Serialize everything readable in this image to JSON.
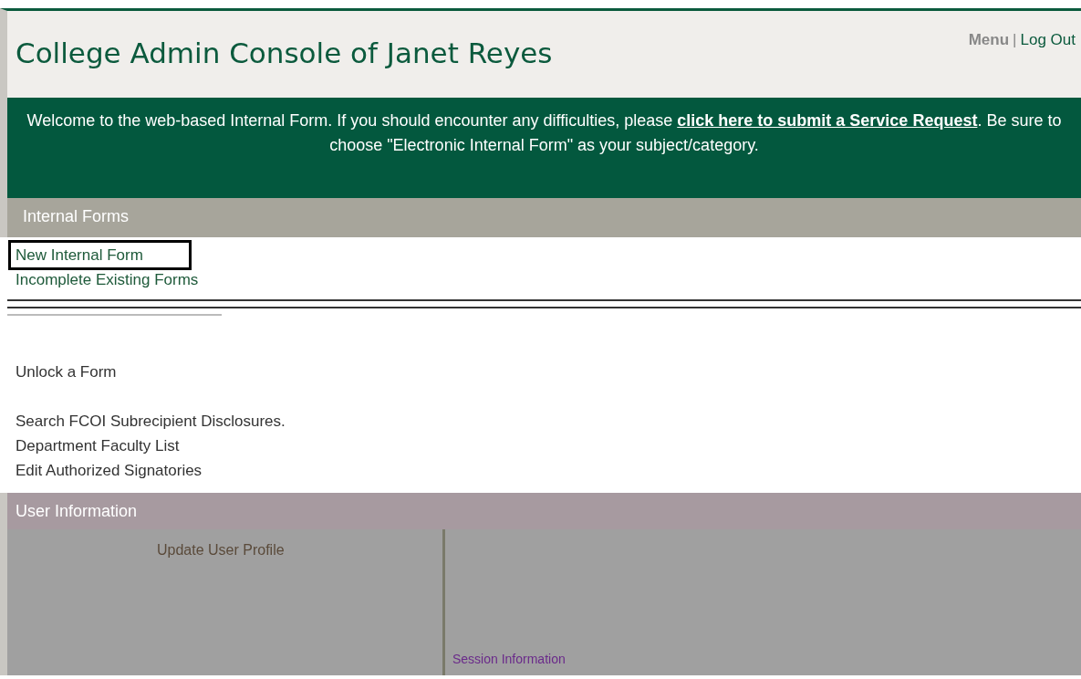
{
  "header": {
    "title": "College Admin Console of Janet Reyes",
    "links": [
      "Menu",
      "Log Out"
    ],
    "separator": "|"
  },
  "banner": {
    "before": "Welcome to the web-based Internal Form. If you should encounter any difficulties, please ",
    "link": "click here to submit a Service Request",
    "after": ". Be sure to choose \"Electronic Internal Form\" as your subject/category."
  },
  "internal_forms": {
    "title": "Internal Forms",
    "items": [
      {
        "label": "New Internal Form",
        "selected": true
      },
      {
        "label": "Incomplete Existing Forms",
        "selected": false
      },
      {
        "label": "Unlock a Form",
        "selected": false
      },
      {
        "label": "Search FCOI Subrecipient Disclosures.",
        "selected": false
      },
      {
        "label": "Department Faculty List",
        "selected": false
      },
      {
        "label": "Edit Authorized Signatories",
        "selected": false
      }
    ]
  },
  "user_information": {
    "title": "User Information",
    "items": [
      {
        "label": "Update User Profile"
      }
    ]
  },
  "session_information": {
    "title": "Session Information"
  }
}
